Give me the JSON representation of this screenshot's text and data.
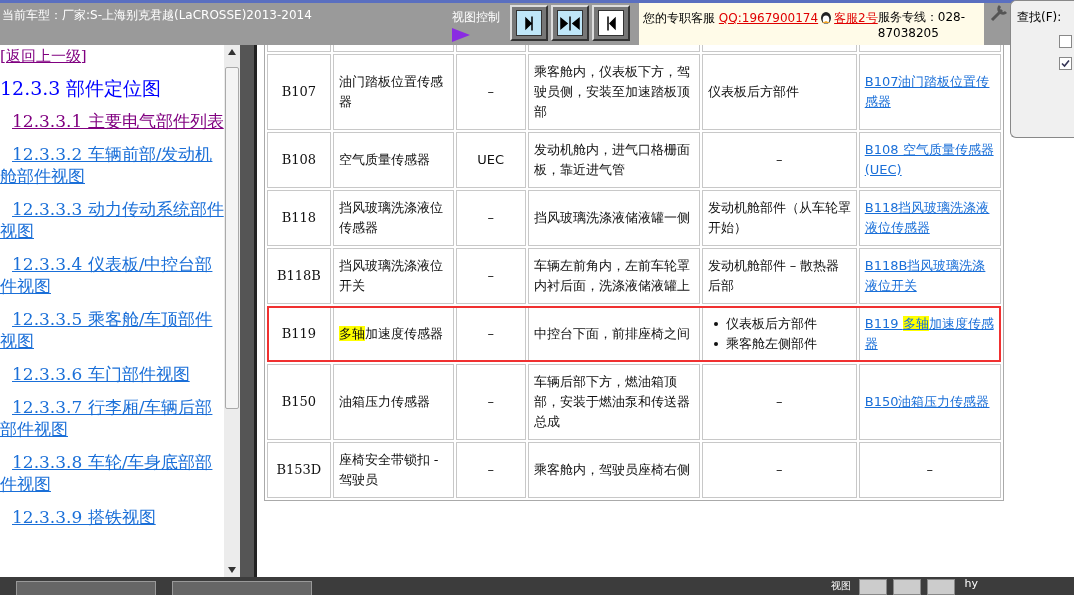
{
  "header": {
    "title": "当前车型：厂家:S-上海别克君越(LaCROSSE)2013-2014",
    "view_control_label": "视图控制",
    "view_buttons": [
      {
        "kind": "right",
        "selected": true
      },
      {
        "kind": "center",
        "selected": true
      },
      {
        "kind": "left",
        "selected": false
      }
    ],
    "service": {
      "label": "您的专职客服 ",
      "qq_link": "QQ:1967900174",
      "agent_link": "客服2号",
      "hotline": "服务专线：028-87038205"
    }
  },
  "sidebar": {
    "back_link": "[返回上一级]",
    "heading": "12.3.3 部件定位图",
    "items": [
      {
        "label": "12.3.3.1 主要电气部件列表",
        "visited": true
      },
      {
        "label": "12.3.3.2 车辆前部/发动机舱部件视图",
        "visited": false
      },
      {
        "label": "12.3.3.3 动力传动系统部件视图",
        "visited": false
      },
      {
        "label": "12.3.3.4 仪表板/中控台部件视图",
        "visited": false
      },
      {
        "label": "12.3.3.5 乘客舱/车顶部件视图",
        "visited": false
      },
      {
        "label": "12.3.3.6 车门部件视图",
        "visited": false
      },
      {
        "label": "12.3.3.7 行李厢/车辆后部部件视图",
        "visited": false
      },
      {
        "label": "12.3.3.8 车轮/车身底部部件视图",
        "visited": false
      },
      {
        "label": "12.3.3.9 搭铁视图",
        "visited": false
      }
    ]
  },
  "table": {
    "rows": [
      {
        "code": "B107",
        "name": [
          {
            "text": "油门踏板位置传感器",
            "highlighted": false
          }
        ],
        "abbr": "–",
        "location": "乘客舱内，仪表板下方，驾驶员侧，安装至加速踏板顶部",
        "views": [
          "仪表板后方部件"
        ],
        "link": [
          {
            "text": "B107油门踏板位置传感器",
            "highlighted": false
          }
        ],
        "boxed": false
      },
      {
        "code": "B108",
        "name": [
          {
            "text": "空气质量传感器",
            "highlighted": false
          }
        ],
        "abbr": "UEC",
        "location": "发动机舱内，进气口格栅面板，靠近进气管",
        "views": [
          "–"
        ],
        "link": [
          {
            "text": "B108 空气质量传感器 (UEC)",
            "highlighted": false
          }
        ],
        "boxed": false
      },
      {
        "code": "B118",
        "name": [
          {
            "text": "挡风玻璃洗涤液位传感器",
            "highlighted": false
          }
        ],
        "abbr": "–",
        "location": "挡风玻璃洗涤液储液罐一侧",
        "views": [
          "发动机舱部件（从车轮罩开始）"
        ],
        "link": [
          {
            "text": "B118挡风玻璃洗涤液液位传感器",
            "highlighted": false
          }
        ],
        "boxed": false
      },
      {
        "code": "B118B",
        "name": [
          {
            "text": "挡风玻璃洗涤液位开关",
            "highlighted": false
          }
        ],
        "abbr": "–",
        "location": "车辆左前角内，左前车轮罩内衬后面，洗涤液储液罐上",
        "views": [
          "发动机舱部件 – 散热器后部"
        ],
        "link": [
          {
            "text": "B118B挡风玻璃洗涤液位开关",
            "highlighted": false
          }
        ],
        "boxed": false
      },
      {
        "code": "B119",
        "name": [
          {
            "text": "多轴",
            "highlighted": true
          },
          {
            "text": "加速度传感器",
            "highlighted": false
          }
        ],
        "abbr": "–",
        "location": "中控台下面，前排座椅之间",
        "views": [
          "仪表板后方部件",
          "乘客舱左侧部件"
        ],
        "link": [
          {
            "text": "B119 ",
            "highlighted": false
          },
          {
            "text": "多轴",
            "highlighted": true
          },
          {
            "text": "加速度传感器",
            "highlighted": false
          }
        ],
        "boxed": true
      },
      {
        "code": "B150",
        "name": [
          {
            "text": "油箱压力传感器",
            "highlighted": false
          }
        ],
        "abbr": "–",
        "location": "车辆后部下方，燃油箱顶部，安装于燃油泵和传送器总成",
        "views": [
          "–"
        ],
        "link": [
          {
            "text": "B150油箱压力传感器",
            "highlighted": false
          }
        ],
        "boxed": false
      },
      {
        "code": "B153D",
        "name": [
          {
            "text": "座椅安全带锁扣 - 驾驶员",
            "highlighted": false
          }
        ],
        "abbr": "–",
        "location": "乘客舱内，驾驶员座椅右侧",
        "views": [
          "–"
        ],
        "link": [],
        "link_text": "–",
        "boxed": false
      }
    ]
  },
  "find_dialog": {
    "label": "查找(F):",
    "options": [
      {
        "checked": false
      },
      {
        "checked": true
      }
    ]
  },
  "footer": {
    "view_label": "视图",
    "user": "hy"
  }
}
